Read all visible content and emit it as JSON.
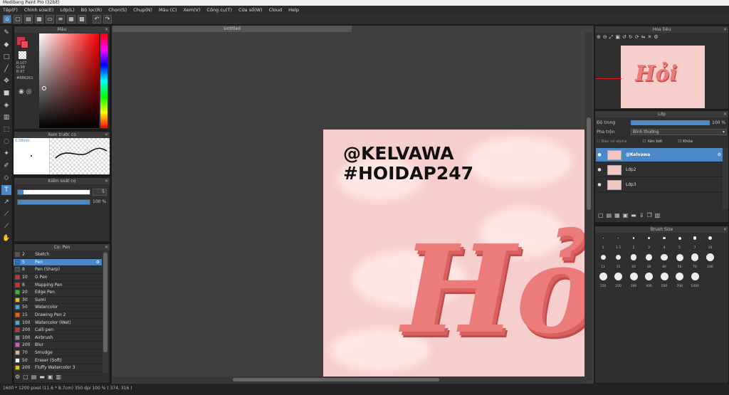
{
  "window": {
    "title": "Medibang Paint Pro (32bit)"
  },
  "menu": [
    "Tệp(F)",
    "Chỉnh sửa(E)",
    "Lớp(L)",
    "Bộ lọc(R)",
    "Chọn(S)",
    "Chụp(N)",
    "Màu (C)",
    "Xem(V)",
    "Công cụ(T)",
    "Cửa sổ(W)",
    "Cloud",
    "Help"
  ],
  "document": {
    "tab": "Untitled"
  },
  "color_panel": {
    "title": "Màu",
    "r": "R:107",
    "g": "G:98",
    "b": "B:97",
    "hex": "#6B6261",
    "primary": "#c8394c",
    "accent": "#e84a5f"
  },
  "brush_preview": {
    "title": "Xem trước cọ",
    "size": "0.38mm"
  },
  "brush_control": {
    "title": "Kiểm soát cọ",
    "size_value": "5",
    "opacity_value": "100 %"
  },
  "brush_panel": {
    "title": "Cọ: Pen",
    "items": [
      {
        "size": "2",
        "name": "Sketch",
        "color": "#555555"
      },
      {
        "size": "5",
        "name": "Pen",
        "color": "#3a6fa8"
      },
      {
        "size": "8",
        "name": "Pen (Sharp)",
        "color": "#444444"
      },
      {
        "size": "10",
        "name": "G Pen",
        "color": "#d03030"
      },
      {
        "size": "8",
        "name": "Mapping Pen",
        "color": "#d03030"
      },
      {
        "size": "20",
        "name": "Edge Pen",
        "color": "#40b040"
      },
      {
        "size": "30",
        "name": "Sumi",
        "color": "#e0c020"
      },
      {
        "size": "50",
        "name": "Watercolor",
        "color": "#40a8e0"
      },
      {
        "size": "15",
        "name": "Drawing Pen 2",
        "color": "#e06020"
      },
      {
        "size": "100",
        "name": "Watercolor (Wet)",
        "color": "#40a8e0"
      },
      {
        "size": "200",
        "name": "Calli pen",
        "color": "#d03030"
      },
      {
        "size": "100",
        "name": "Airbrush",
        "color": "#888888"
      },
      {
        "size": "200",
        "name": "Blur",
        "color": "#c060c0"
      },
      {
        "size": "70",
        "name": "Smudge",
        "color": "#e0b090"
      },
      {
        "size": "50",
        "name": "Eraser (Soft)",
        "color": "#ffffff"
      },
      {
        "size": "200",
        "name": "Fluffy Watercolor 3",
        "color": "#e0c020"
      }
    ]
  },
  "navigator": {
    "title": "Hoa tiêu"
  },
  "layer_panel": {
    "title": "Lớp",
    "opacity_label": "Độ trong",
    "opacity_value": "100 %",
    "blend_label": "Pha trộn",
    "blend_value": "Bình thường",
    "protect_alpha": "Bảo vệ alpha",
    "clipping": "Xén bớt",
    "lock": "Khóa",
    "layers": [
      {
        "name": "@Kelvawa",
        "selected": true
      },
      {
        "name": "Lớp2",
        "selected": false
      },
      {
        "name": "Lớp3",
        "selected": false
      }
    ]
  },
  "brush_size_panel": {
    "title": "Brush Size",
    "sizes": [
      "1",
      "1.5",
      "2",
      "3",
      "4",
      "5",
      "7",
      "10",
      "11",
      "15",
      "20",
      "30",
      "40",
      "50",
      "70",
      "100",
      "150",
      "200",
      "300",
      "400",
      "500",
      "700",
      "1000"
    ]
  },
  "artwork": {
    "line1": "@KELVAWA",
    "line2": "#HOIDAP247",
    "big": "Hỏi"
  },
  "status": {
    "text": "1600 * 1200 pixel   (11.6 * 8.7cm)   350 dpi   100 %   ( 374, 316 )"
  }
}
